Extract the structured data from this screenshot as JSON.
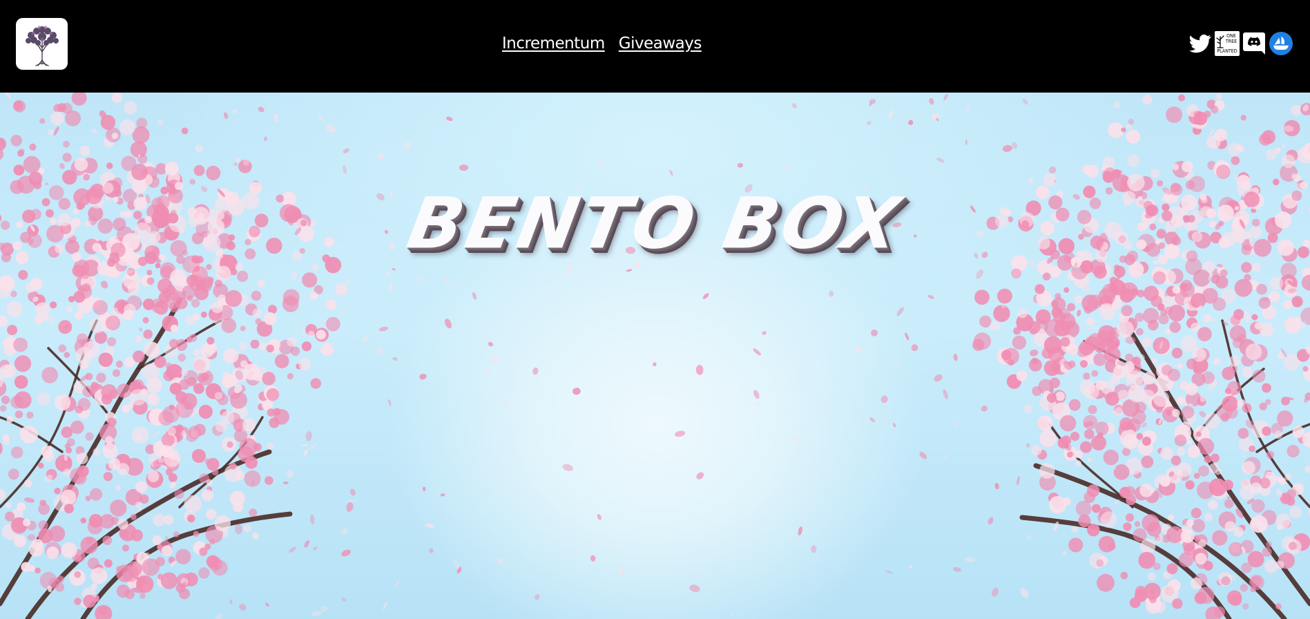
{
  "header": {
    "logo": {
      "icon": "tree-logo-icon"
    },
    "nav": {
      "items": [
        {
          "label": "Incrementum"
        },
        {
          "label": "Giveaways"
        }
      ]
    },
    "socials": [
      {
        "icon": "twitter-icon",
        "color": "#ffffff"
      },
      {
        "icon": "one-tree-planted-icon",
        "lines": [
          "ONE",
          "TREE"
        ],
        "bottom": "PLANTED"
      },
      {
        "icon": "discord-icon",
        "color": "#ffffff"
      },
      {
        "icon": "opensea-icon",
        "color": "#2081e2"
      }
    ]
  },
  "hero": {
    "title": "BENTO BOX",
    "colors": {
      "sky": "#c3e8f9",
      "blossom_pink": "#f08db2",
      "blossom_light": "#fbe1ea",
      "branch": "#4a2a26"
    }
  }
}
